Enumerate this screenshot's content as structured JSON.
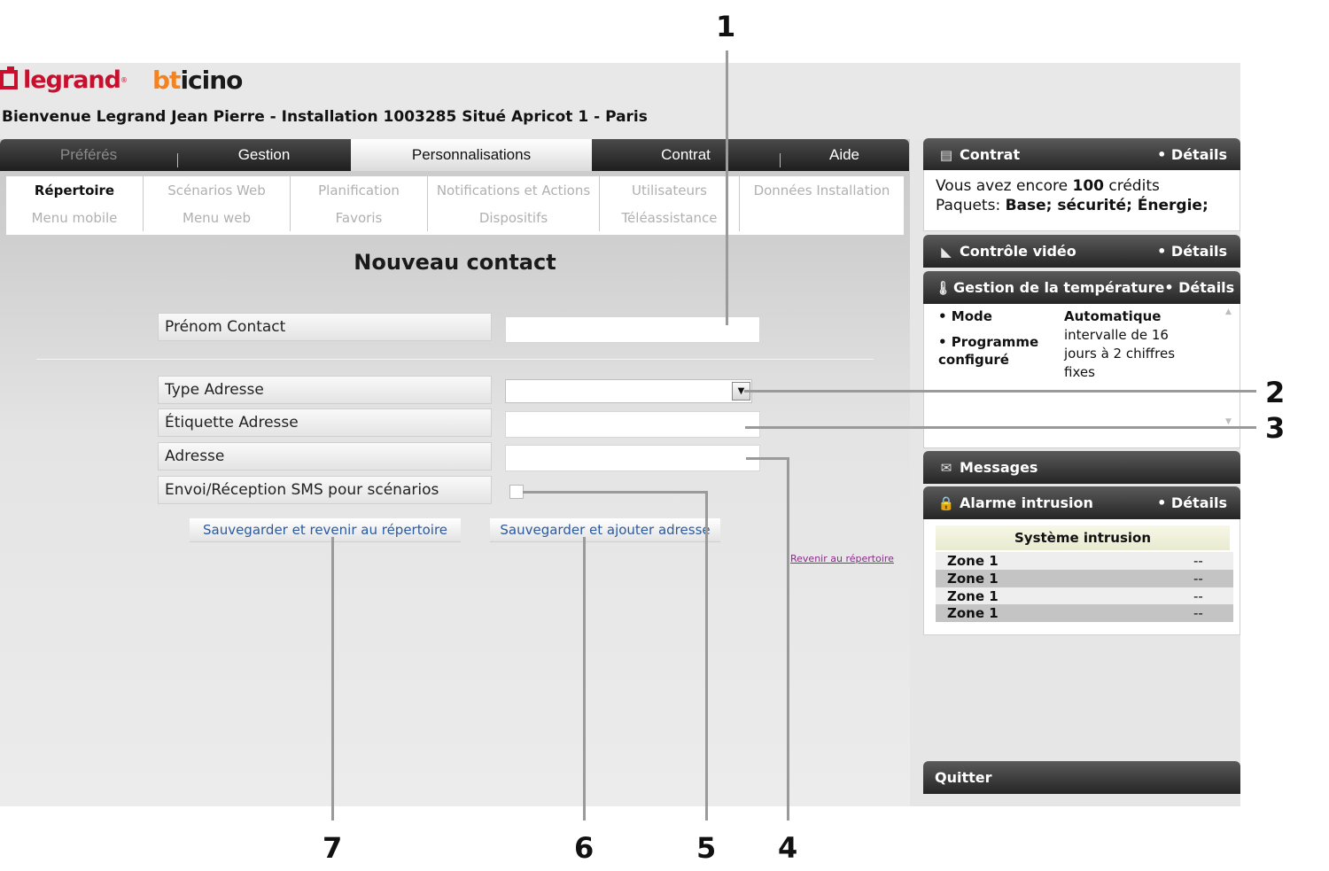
{
  "branding": {
    "legrand": "legrand",
    "legrand_reg": "®",
    "bticino_b": "bt",
    "bticino_rest": "icino"
  },
  "header": {
    "welcome": "Bienvenue Legrand Jean Pierre - Installation 1003285 Situé Apricot 1 - Paris"
  },
  "main_tabs": [
    {
      "label": "Préférés",
      "state": "muted"
    },
    {
      "label": "Gestion",
      "state": "normal"
    },
    {
      "label": "Personnalisations",
      "state": "active"
    },
    {
      "label": "Contrat",
      "state": "normal"
    },
    {
      "label": "Aide",
      "state": "normal"
    }
  ],
  "sub_nav": {
    "row1": [
      "Répertoire",
      "Scénarios Web",
      "Planification",
      "Notifications et Actions",
      "Utilisateurs",
      "Données Installation"
    ],
    "row2": [
      "Menu mobile",
      "Menu web",
      "Favoris",
      "Dispositifs",
      "Téléassistance",
      ""
    ],
    "active": "Répertoire"
  },
  "form": {
    "title": "Nouveau contact",
    "first_name_label": "Prénom Contact",
    "first_name_value": "",
    "address_type_label": "Type Adresse",
    "address_type_value": "",
    "address_label_label": "Étiquette Adresse",
    "address_label_value": "",
    "address_label": "Adresse",
    "address_value": "",
    "sms_label": "Envoi/Réception SMS pour scénarios",
    "sms_checked": false,
    "save_back_label": "Sauvegarder et revenir au répertoire",
    "save_add_label": "Sauvegarder et ajouter adresse",
    "back_link_label": "Revenir au répertoire"
  },
  "widgets": {
    "contrat": {
      "title": "Contrat",
      "details": "• Détails",
      "line1_prefix": "Vous avez encore ",
      "line1_credits": "100",
      "line1_suffix": " crédits",
      "line2_prefix": "Paquets: ",
      "line2_packages": "Base; sécurité; Énergie;",
      "icon": "document-icon"
    },
    "video": {
      "title": "Contrôle vidéo",
      "details": "• Détails",
      "icon": "camera-icon"
    },
    "temperature": {
      "title": "Gestion de la température",
      "details": "• Détails",
      "icon": "thermometer-icon",
      "mode_label": "• Mode",
      "mode_value": "Automatique",
      "program_label_1": "• Programme",
      "program_label_2": "configuré",
      "program_value_1": "intervalle de 16",
      "program_value_2": "jours à 2 chiffres",
      "program_value_3": "fixes"
    },
    "messages": {
      "title": "Messages",
      "icon": "envelope-icon"
    },
    "alarm": {
      "title": "Alarme intrusion",
      "details": "• Détails",
      "icon": "padlock-icon",
      "system_title": "Système intrusion",
      "zones": [
        {
          "name": "Zone 1",
          "status": "--"
        },
        {
          "name": "Zone 1",
          "status": "--"
        },
        {
          "name": "Zone 1",
          "status": "--"
        },
        {
          "name": "Zone 1",
          "status": "--"
        }
      ]
    },
    "quit_label": "Quitter"
  },
  "callouts": [
    "1",
    "2",
    "3",
    "4",
    "5",
    "6",
    "7"
  ],
  "colors": {
    "legrand_red": "#c8102e",
    "bticino_orange": "#f58220",
    "link_blue": "#2b5a9e",
    "visited_link": "#8b2a8b",
    "header_dark": "#252525"
  }
}
